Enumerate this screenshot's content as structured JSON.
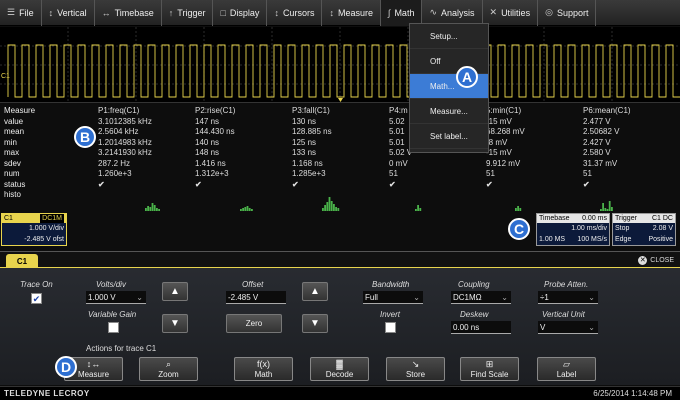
{
  "menu": [
    {
      "icon": "file-icon",
      "glyph": "☰",
      "label": "File"
    },
    {
      "icon": "vertical-icon",
      "glyph": "↕",
      "label": "Vertical"
    },
    {
      "icon": "timebase-icon",
      "glyph": "↔",
      "label": "Timebase"
    },
    {
      "icon": "trigger-icon",
      "glyph": "↑",
      "label": "Trigger"
    },
    {
      "icon": "display-icon",
      "glyph": "□",
      "label": "Display"
    },
    {
      "icon": "cursors-icon",
      "glyph": "↕",
      "label": "Cursors"
    },
    {
      "icon": "measure-icon",
      "glyph": "↕",
      "label": "Measure"
    },
    {
      "icon": "math-icon",
      "glyph": "∫",
      "label": "Math"
    },
    {
      "icon": "analysis-icon",
      "glyph": "∿",
      "label": "Analysis"
    },
    {
      "icon": "utilities-icon",
      "glyph": "✕",
      "label": "Utilities"
    },
    {
      "icon": "support-icon",
      "glyph": "◎",
      "label": "Support"
    }
  ],
  "trace_label": "C1",
  "math_menu": [
    "Setup...",
    "Off",
    "Math...",
    "Measure...",
    "Set label..."
  ],
  "math_menu_selected": 2,
  "callouts": {
    "a": "A",
    "b": "B",
    "c": "C",
    "d": "D"
  },
  "measure": {
    "header": [
      "Measure",
      "P1:freq(C1)",
      "P2:rise(C1)",
      "P3:fall(C1)",
      "P4:m",
      "5:min(C1)",
      "P6:mean(C1)"
    ],
    "rows": [
      {
        "label": "value",
        "cells": [
          "3.1012385 kHz",
          "147 ns",
          "130 ns",
          "5.02",
          "-15 mV",
          "2.477 V"
        ]
      },
      {
        "label": "mean",
        "cells": [
          "2.5604 kHz",
          "144.430 ns",
          "128.885 ns",
          "5.01",
          "68.268 mV",
          "2.50682 V"
        ]
      },
      {
        "label": "min",
        "cells": [
          "1.2014983 kHz",
          "140 ns",
          "125 ns",
          "5.01",
          "-8 mV",
          "2.427 V"
        ]
      },
      {
        "label": "max",
        "cells": [
          "3.2141930 kHz",
          "148 ns",
          "133 ns",
          "5.02 V",
          "-15 mV",
          "2.580 V"
        ]
      },
      {
        "label": "sdev",
        "cells": [
          "287.2 Hz",
          "1.416 ns",
          "1.168 ns",
          "0 mV",
          "9.912 mV",
          "31.37 mV"
        ]
      },
      {
        "label": "num",
        "cells": [
          "1.260e+3",
          "1.312e+3",
          "1.285e+3",
          "51",
          "51",
          "51"
        ]
      }
    ],
    "status_label": "status",
    "status_mark": "✔",
    "histo_label": "histo"
  },
  "c1_descriptor": {
    "name": "C1",
    "coupling": "DC1M",
    "vdiv": "1.000 V/div",
    "offset": "-2.485 V ofst"
  },
  "timebase": {
    "title": "Timebase",
    "delay": "0.00 ms",
    "tdiv": "1.00 ms/div",
    "samples": "1.00 MS",
    "rate": "100 MS/s"
  },
  "trigger": {
    "title": "Trigger",
    "channel": "C1",
    "coupling": "DC",
    "mode": "Stop",
    "level": "2.08 V",
    "type": "Edge",
    "slope": "Positive"
  },
  "dialog": {
    "tab": "C1",
    "close": "CLOSE",
    "trace_on_label": "Trace On",
    "trace_on_mark": "✔",
    "volts_label": "Volts/div",
    "volts_value": "1.000 V",
    "variable_gain_label": "Variable Gain",
    "offset_label": "Offset",
    "offset_value": "-2.485 V",
    "zero_label": "Zero",
    "bandwidth_label": "Bandwidth",
    "bandwidth_value": "Full",
    "invert_label": "Invert",
    "coupling_label": "Coupling",
    "coupling_value": "DC1MΩ",
    "deskew_label": "Deskew",
    "deskew_value": "0.00 ns",
    "probe_label": "Probe Atten.",
    "probe_value": "÷1",
    "unit_label": "Vertical Unit",
    "unit_value": "V",
    "actions_label": "Actions for trace C1",
    "actions": [
      {
        "icon": "measure-action-icon",
        "glyph": "↕↔",
        "label": "Measure"
      },
      {
        "icon": "zoom-action-icon",
        "glyph": "⌕",
        "label": "Zoom"
      },
      {
        "icon": "math-action-icon",
        "glyph": "f(x)",
        "label": "Math"
      },
      {
        "icon": "decode-action-icon",
        "glyph": "▓",
        "label": "Decode"
      },
      {
        "icon": "store-action-icon",
        "glyph": "↘",
        "label": "Store"
      },
      {
        "icon": "find-scale-action-icon",
        "glyph": "⊞",
        "label": "Find Scale"
      },
      {
        "icon": "label-action-icon",
        "glyph": "▱",
        "label": "Label"
      }
    ]
  },
  "footer": {
    "brand": "TELEDYNE LECROY",
    "datetime": "6/25/2014 1:14:48 PM"
  },
  "colors": {
    "trace": "#e8d44d",
    "accent": "#2e6fd1",
    "status_ok": "#4ab34a"
  }
}
